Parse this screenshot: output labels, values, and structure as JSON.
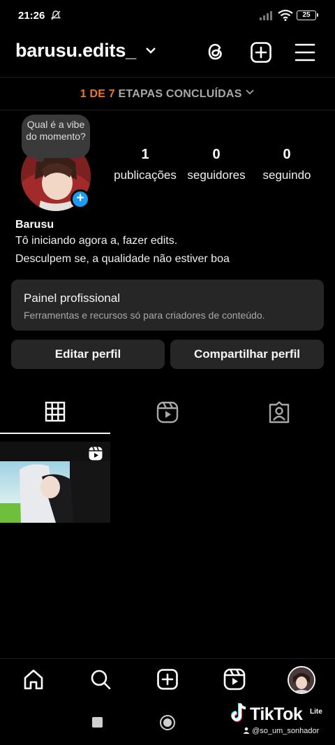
{
  "status_bar": {
    "time": "21:26",
    "battery": "25"
  },
  "header": {
    "username": "barusu.edits_"
  },
  "setup_steps": {
    "done": "1 DE 7",
    "label": "ETAPAS CONCLUÍDAS"
  },
  "note": {
    "text": "Qual é a vibe do momento?"
  },
  "stats": [
    {
      "value": "1",
      "label": "publicações"
    },
    {
      "value": "0",
      "label": "seguidores"
    },
    {
      "value": "0",
      "label": "seguindo"
    }
  ],
  "bio": {
    "name": "Barusu",
    "line1": "Tô iniciando agora a, fazer edits.",
    "line2": "Desculpem se, a qualidade não estiver boa"
  },
  "professional_panel": {
    "title": "Painel profissional",
    "subtitle": "Ferramentas e recursos só para criadores de conteúdo."
  },
  "buttons": {
    "edit": "Editar perfil",
    "share": "Compartilhar perfil"
  },
  "watermark": {
    "brand": "TikTok",
    "tag": "Lite",
    "user": "@so_um_sonhador"
  },
  "colors": {
    "accent_orange": "#f0762b",
    "add_blue": "#1c9bf0",
    "surface": "#262626"
  }
}
